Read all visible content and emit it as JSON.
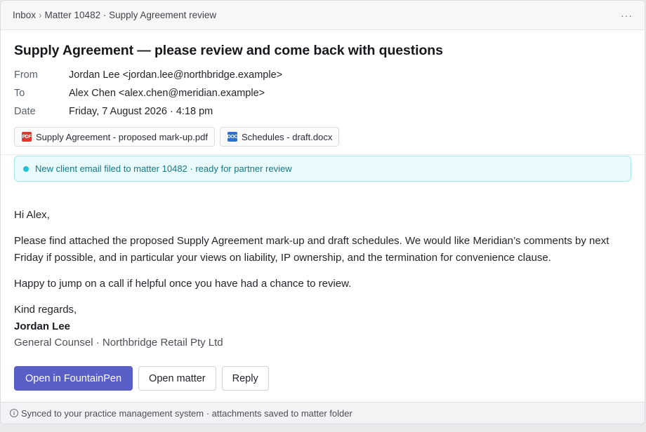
{
  "breadcrumb": {
    "inbox": "Inbox",
    "separator": "›",
    "current": "Matter 10482 · Supply Agreement review"
  },
  "topbar": {
    "more_label": "···"
  },
  "email": {
    "subject": "Supply Agreement — please review and come back with questions",
    "from_label": "From",
    "from_value": "Jordan Lee <jordan.lee@northbridge.example>",
    "to_label": "To",
    "to_value": "Alex Chen <alex.chen@meridian.example>",
    "date_label": "Date",
    "date_value": "Friday, 7 August 2026 · 4:18 pm",
    "attachments": [
      {
        "name": "Supply Agreement - proposed mark-up.pdf",
        "icon": "pdf-file-icon",
        "badge": "PDF",
        "color": "#d93a2f"
      },
      {
        "name": "Schedules - draft.docx",
        "icon": "docx-file-icon",
        "badge": "DOC",
        "color": "#2f6fd1"
      }
    ]
  },
  "banner": {
    "text": "New client email filed to matter 10482 · ready for partner review",
    "accent": "#1fc3d6"
  },
  "body": {
    "greeting": "Hi Alex,",
    "paragraph1": "Please find attached the proposed Supply Agreement mark-up and draft schedules. We would like Meridian’s comments by next Friday if possible, and in particular your views on liability, IP ownership, and the termination for convenience clause.",
    "paragraph2": "Happy to jump on a call if helpful once you have had a chance to review.",
    "closing": "Kind regards,",
    "signer_name": "Jordan Lee",
    "signer_role": "General Counsel · Northbridge Retail Pty Ltd"
  },
  "actions": {
    "open_fountainpen": "Open in FountainPen",
    "open_matter": "Open matter",
    "reply": "Reply",
    "primary_color": "#5a5fc8"
  },
  "footer": {
    "icon": "info-icon",
    "icon_glyph": "i",
    "text": "Synced to your practice management system · attachments saved to matter folder"
  }
}
